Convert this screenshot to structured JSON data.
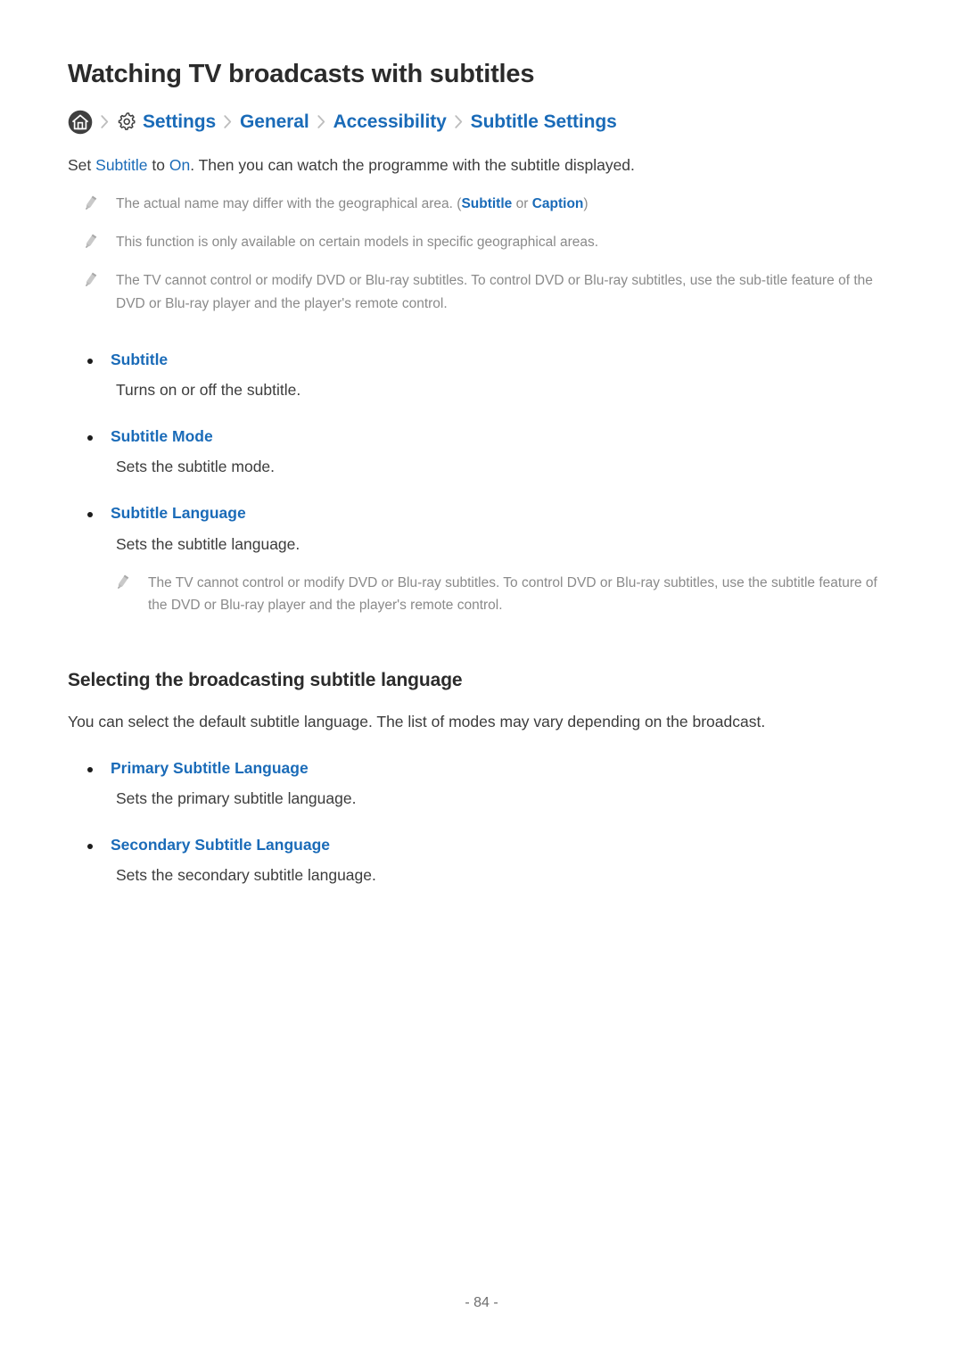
{
  "page": {
    "title": "Watching TV broadcasts with subtitles",
    "footer": "- 84 -",
    "accent_color": "#1a6bb8",
    "text_color": "#3c3c3c",
    "note_color": "#8a8a8a"
  },
  "breadcrumb": {
    "home_icon": "home-icon",
    "gear_icon": "gear-icon",
    "separator": "chevron-right-icon",
    "items": [
      {
        "label": "Settings"
      },
      {
        "label": "General"
      },
      {
        "label": "Accessibility"
      },
      {
        "label": "Subtitle Settings"
      }
    ]
  },
  "intro": {
    "part1": "Set ",
    "term1": "Subtitle",
    "part2": " to ",
    "term2": "On",
    "part3": ". Then you can watch the programme with the subtitle displayed."
  },
  "notes_top": [
    {
      "icon": "pencil-icon",
      "part1": "The actual name may differ with the geographical area. (",
      "term1": "Subtitle",
      "part2": " or ",
      "term2": "Caption",
      "part3": ")"
    },
    {
      "icon": "pencil-icon",
      "text": "This function is only available on certain models in specific geographical areas."
    },
    {
      "icon": "pencil-icon",
      "text": "The TV cannot control or modify DVD or Blu-ray subtitles. To control DVD or Blu-ray subtitles, use the sub-title feature of the DVD or Blu-ray player and the player's remote control."
    }
  ],
  "list_one": [
    {
      "label": "Subtitle",
      "desc": "Turns on or off the subtitle."
    },
    {
      "label": "Subtitle Mode",
      "desc": "Sets the subtitle mode."
    },
    {
      "label": "Subtitle Language",
      "desc": "Sets the subtitle language."
    }
  ],
  "note_after_list": {
    "icon": "pencil-icon",
    "text": "The TV cannot control or modify DVD or Blu-ray subtitles. To control DVD or Blu-ray subtitles, use the subtitle feature of the DVD or Blu-ray player and the player's remote control."
  },
  "section_two": {
    "heading": "Selecting the broadcasting subtitle language",
    "intro": "You can select the default subtitle language. The list of modes may vary depending on the broadcast.",
    "items": [
      {
        "label": "Primary Subtitle Language",
        "desc": "Sets the primary subtitle language."
      },
      {
        "label": "Secondary Subtitle Language",
        "desc": "Sets the secondary subtitle language."
      }
    ]
  }
}
